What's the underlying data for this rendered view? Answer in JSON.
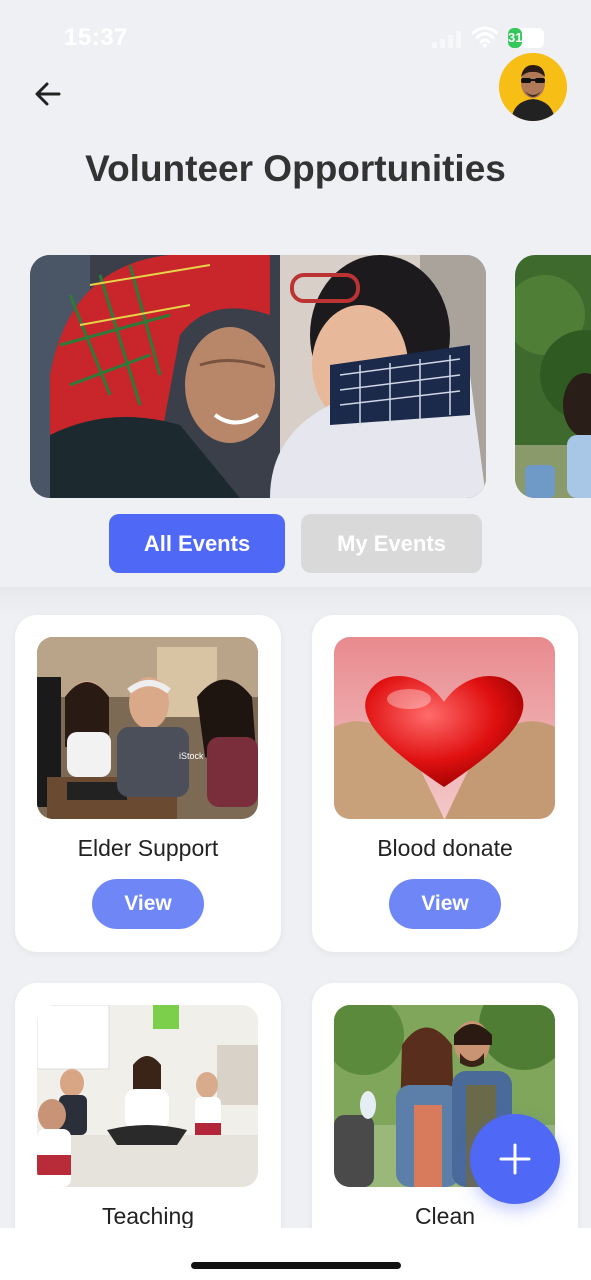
{
  "status_bar": {
    "time": "15:37",
    "battery": "31"
  },
  "header": {
    "title": "Volunteer Opportunities",
    "back_icon": "arrow-left-icon",
    "avatar_icon": "user-avatar"
  },
  "tabs": [
    {
      "label": "All Events",
      "active": true
    },
    {
      "label": "My Events",
      "active": false
    }
  ],
  "cards": [
    {
      "title": "Elder Support",
      "button": "View"
    },
    {
      "title": "Blood donate",
      "button": "View"
    },
    {
      "title": "Teaching",
      "button": ""
    },
    {
      "title": "Clean",
      "button": ""
    }
  ],
  "fab": {
    "icon": "plus-icon"
  },
  "colors": {
    "accent": "#4f68f5",
    "button": "#6f86f6",
    "inactive_tab": "#d9d9d9",
    "background": "#eef0f3"
  }
}
